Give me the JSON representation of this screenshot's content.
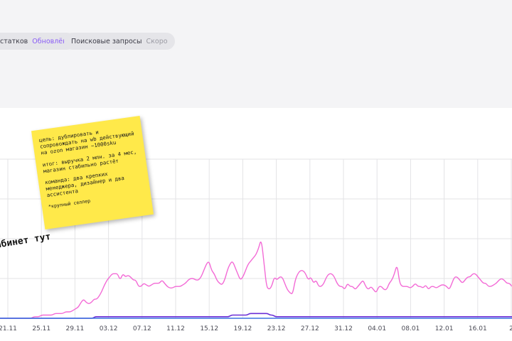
{
  "filters": {
    "stock": {
      "label": "статков",
      "status": "Обновлён"
    },
    "search": {
      "label": "Поисковые запросы",
      "status": "Скоро"
    }
  },
  "sticky_note": {
    "goal": "цель: дублировать и сопровождать на wb действующий на ozon магазин ~1000sku",
    "result": "итог: выручка 2 млн. за 4 мес, магазин стабильно растёт",
    "team": "команда: два крепких менеджера, дизайнер и два ассистента",
    "note": "*крупный селлер"
  },
  "handwritten_label": "абинет тут",
  "chart_data": {
    "type": "line",
    "x_ticks": [
      "21.11",
      "25.11",
      "29.11",
      "03.12",
      "07.12",
      "11.12",
      "15.12",
      "19.12",
      "23.12",
      "27.12",
      "31.12",
      "04.01",
      "08.01",
      "12.01",
      "16.01",
      "2"
    ],
    "ylim": [
      0,
      100
    ],
    "grid": true,
    "series": [
      {
        "color": "#f36bd6",
        "values": [
          0,
          0,
          0,
          0,
          0,
          0,
          0,
          0,
          0,
          0,
          0,
          0,
          0,
          1,
          1,
          1,
          2,
          2,
          2,
          2,
          2,
          3,
          3,
          3,
          3,
          4,
          4,
          4,
          5,
          6,
          7,
          10,
          12,
          10,
          9,
          10,
          12,
          12,
          14,
          17,
          21,
          24,
          26,
          28,
          28,
          28,
          24,
          28,
          26,
          27,
          26,
          24,
          24,
          20,
          20,
          22,
          21,
          20,
          21,
          22,
          22,
          22,
          24,
          22,
          20,
          19,
          19,
          20,
          20,
          20,
          21,
          22,
          24,
          25,
          25,
          24,
          24,
          26,
          30,
          34,
          36,
          30,
          28,
          24,
          22,
          21,
          24,
          30,
          34,
          36,
          32,
          28,
          24,
          26,
          30,
          34,
          36,
          38,
          40,
          44,
          50,
          36,
          20,
          18,
          20,
          26,
          24,
          26,
          26,
          22,
          18,
          16,
          15,
          24,
          28,
          30,
          30,
          28,
          24,
          26,
          22,
          24,
          20,
          20,
          22,
          26,
          28,
          28,
          26,
          22,
          20,
          20,
          18,
          22,
          20,
          20,
          18,
          20,
          22,
          24,
          20,
          18,
          20,
          18,
          16,
          20,
          20,
          18,
          18,
          22,
          24,
          28,
          34,
          22,
          20,
          20,
          20,
          19,
          20,
          22,
          20,
          20,
          19,
          21,
          18,
          20,
          20,
          19,
          20,
          21,
          21,
          20,
          18,
          22,
          26,
          26,
          24,
          22,
          24,
          26,
          26,
          28,
          28,
          26,
          24,
          22,
          22,
          20,
          20,
          21,
          22,
          24,
          25,
          24,
          22,
          22,
          20
        ]
      },
      {
        "color": "#6b2fd6",
        "values": [
          0,
          0,
          0,
          0,
          0,
          0,
          0,
          0,
          0,
          0,
          0,
          0,
          0,
          0,
          0,
          0,
          0,
          0,
          0,
          0,
          0,
          0,
          0,
          0,
          0,
          0,
          0,
          0,
          0,
          0,
          0,
          0,
          0,
          0,
          0,
          0,
          0,
          1,
          1,
          1,
          1,
          1,
          1,
          1,
          1,
          1,
          1,
          1,
          1,
          1,
          1,
          1,
          1,
          1,
          1,
          1,
          1,
          1,
          1,
          1,
          1,
          1,
          1,
          1,
          1,
          1,
          1,
          1,
          1,
          1,
          1,
          1,
          1,
          1,
          1,
          1,
          1,
          1,
          1,
          1,
          1,
          1,
          1,
          1,
          1,
          1,
          1,
          1,
          1,
          1,
          2,
          2,
          2,
          2,
          2,
          2,
          2,
          3,
          3,
          3,
          3,
          3,
          3,
          3,
          3,
          2,
          2,
          1,
          1,
          1,
          1,
          1,
          1,
          1,
          1,
          1,
          1,
          1,
          1,
          1,
          1,
          1,
          1,
          1,
          1,
          1,
          1,
          1,
          1,
          1,
          1,
          1,
          1,
          1,
          1,
          1,
          1,
          1,
          1,
          1,
          1,
          1,
          1,
          1,
          1,
          1,
          1,
          1,
          1,
          1,
          1,
          1,
          1,
          1,
          1,
          1,
          1,
          1,
          1,
          1,
          1,
          1,
          1,
          1,
          1,
          1,
          1,
          1,
          1,
          1,
          1,
          1,
          1,
          1,
          1,
          1,
          1,
          1,
          1,
          1,
          1,
          1,
          1,
          1,
          1,
          1,
          1,
          1,
          1,
          1,
          1,
          1,
          1,
          1,
          1,
          1,
          1,
          1,
          1,
          1
        ]
      },
      {
        "color": "#3b74e0",
        "values": [
          0,
          0,
          0,
          0,
          0,
          0,
          0,
          0,
          0,
          0,
          0,
          0,
          0,
          0,
          0,
          0,
          0,
          0,
          0,
          0,
          0,
          0,
          0,
          0,
          0,
          0,
          0,
          0,
          0,
          0,
          0,
          0,
          0,
          0,
          0,
          0,
          0,
          0,
          0,
          0,
          0,
          0,
          0,
          0,
          0,
          0,
          0,
          0,
          0,
          0,
          0,
          0,
          0,
          0,
          0,
          0,
          0,
          0,
          0,
          0,
          0,
          0,
          0,
          0,
          0,
          0,
          0,
          0,
          0,
          0,
          0,
          0,
          0,
          0,
          0,
          0,
          0,
          0,
          0,
          0,
          0,
          0,
          0,
          0,
          0,
          0,
          0,
          0,
          0,
          0,
          0,
          0,
          0,
          0,
          0,
          0,
          0,
          0,
          0,
          0,
          0,
          0,
          0,
          0,
          0,
          0,
          0,
          0,
          0,
          0,
          0,
          0,
          0,
          0,
          0,
          0,
          0,
          0,
          0,
          0,
          0,
          0,
          0,
          0,
          0,
          0,
          0,
          0,
          0,
          0,
          0,
          0,
          0,
          0,
          0,
          0,
          0,
          0,
          0,
          0,
          0,
          0,
          0,
          0,
          0,
          0,
          0,
          0,
          0,
          0,
          0,
          0,
          0,
          0,
          0,
          0,
          0,
          0,
          0,
          0,
          0,
          0,
          0,
          0,
          0,
          0,
          0,
          0,
          0,
          0,
          0,
          0,
          0,
          0,
          0,
          0,
          0,
          0,
          0,
          0,
          0,
          0,
          0,
          0,
          0,
          0,
          0,
          0,
          0,
          0,
          0,
          0,
          0,
          0,
          0,
          0,
          0,
          0,
          0,
          0,
          0,
          0,
          0,
          0,
          0
        ]
      }
    ]
  }
}
